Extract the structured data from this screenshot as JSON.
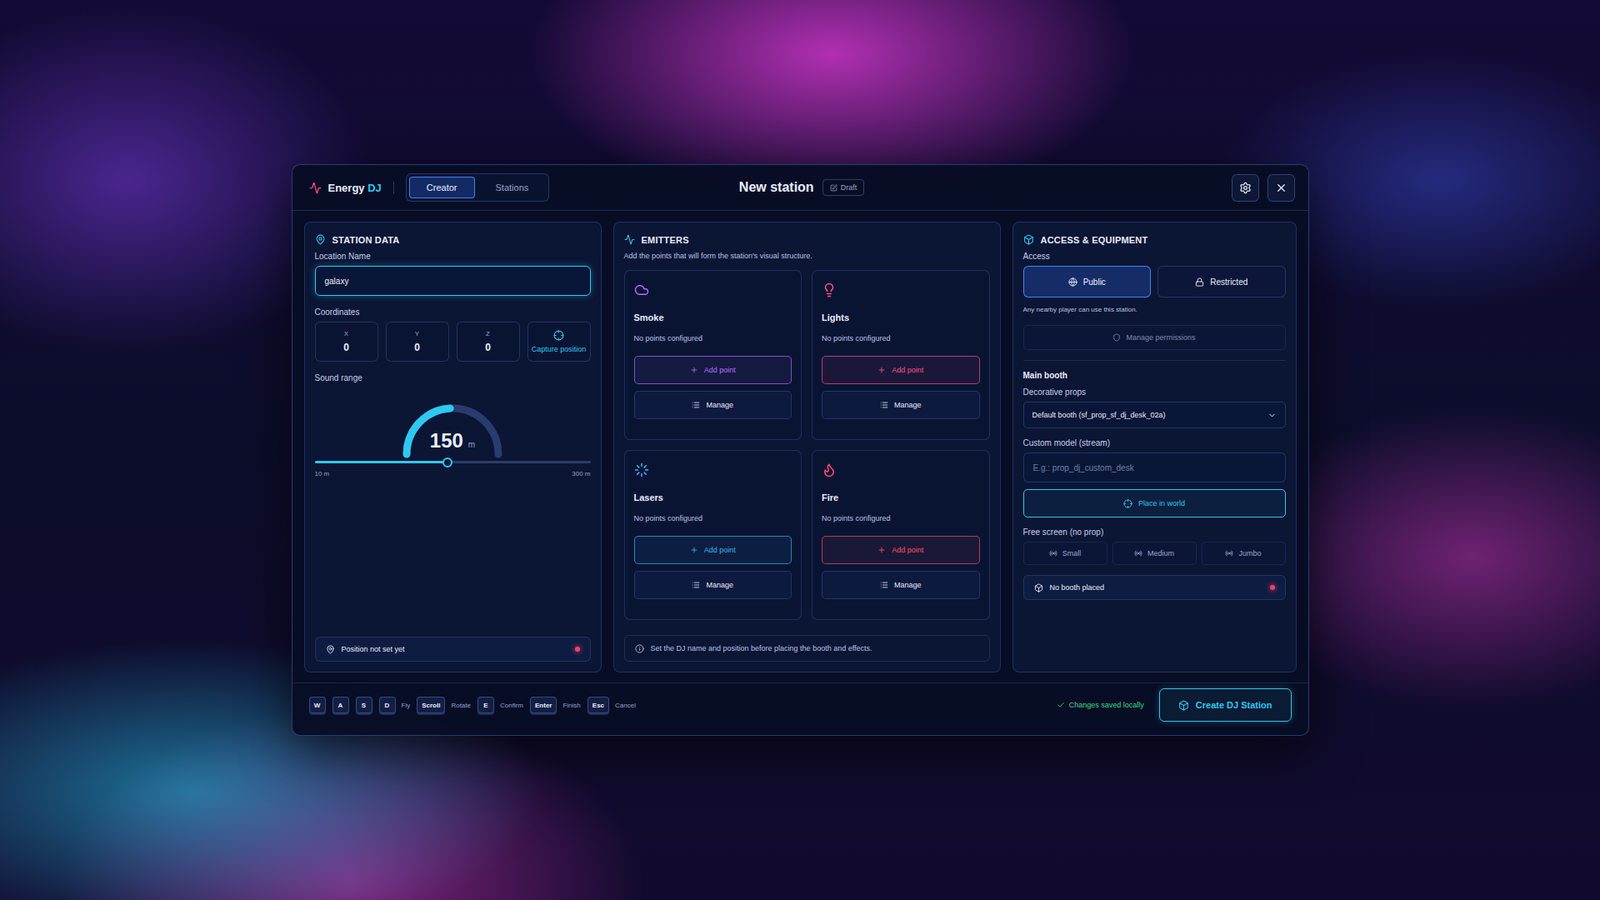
{
  "app": {
    "brand_primary": "Energy",
    "brand_accent": "DJ"
  },
  "tabs": [
    {
      "label": "Creator",
      "selected": true
    },
    {
      "label": "Stations",
      "selected": false
    }
  ],
  "title": "New station",
  "badge": "Draft",
  "station_data": {
    "title": "STATION DATA",
    "location_label": "Location Name",
    "location_value": "galaxy",
    "coordinates_label": "Coordinates",
    "coordinates": [
      {
        "axis": "X",
        "value": "0"
      },
      {
        "axis": "Y",
        "value": "0"
      },
      {
        "axis": "Z",
        "value": "0"
      }
    ],
    "capture": "Capture position",
    "sound_range_label": "Sound range",
    "sound_range_value": "150",
    "sound_range_unit": "m",
    "level": 0.483,
    "min": "10 m",
    "max": "300 m",
    "status": {
      "text": "Position not set yet",
      "ok": false
    }
  },
  "emitters": {
    "title": "EMITTERS",
    "subtitle": "Add the points that will form the station's visual structure.",
    "items": [
      {
        "name": "Smoke",
        "status": "No points configured",
        "add": "Add point",
        "manage": "Manage",
        "color": "#b86cff"
      },
      {
        "name": "Lights",
        "status": "No points configured",
        "add": "Add point",
        "manage": "Manage",
        "color": "#ff4f8e"
      },
      {
        "name": "Lasers",
        "status": "No points configured",
        "add": "Add point",
        "manage": "Manage",
        "color": "#38b6f8"
      },
      {
        "name": "Fire",
        "status": "No points configured",
        "add": "Add point",
        "manage": "Manage",
        "color": "#ff4f6e"
      }
    ],
    "note": "Set the DJ name and position before placing the booth and effects."
  },
  "access": {
    "title": "ACCESS & EQUIPMENT",
    "access_label": "Access",
    "options": [
      {
        "label": "Public",
        "selected": true
      },
      {
        "label": "Restricted",
        "selected": false
      }
    ],
    "hint": "Any nearby player can use this station.",
    "manage_permissions": {
      "label": "Manage permissions",
      "disabled": true
    },
    "main_booth": "Main booth",
    "props_label": "Decorative props",
    "props_value": "Default booth (sf_prop_sf_dj_desk_02a)",
    "custom_label": "Custom model (stream)",
    "custom_placeholder": "E.g.: prop_dj_custom_desk",
    "place": "Place in world",
    "screen_label": "Free screen (no prop)",
    "sizes": [
      {
        "label": "Small",
        "selected": false
      },
      {
        "label": "Medium",
        "selected": false
      },
      {
        "label": "Jumbo",
        "selected": false
      }
    ],
    "status": {
      "text": "No booth placed",
      "ok": false
    }
  },
  "footer": {
    "keys": [
      {
        "key": "W",
        "label": ""
      },
      {
        "key": "A",
        "label": ""
      },
      {
        "key": "S",
        "label": ""
      },
      {
        "key": "D",
        "label": "Fly"
      },
      {
        "key": "Scroll",
        "label": "Rotate"
      },
      {
        "key": "E",
        "label": "Confirm"
      },
      {
        "key": "Enter",
        "label": "Finish"
      },
      {
        "key": "Esc",
        "label": "Cancel"
      }
    ],
    "saved": "Changes saved locally",
    "create": "Create DJ Station"
  }
}
